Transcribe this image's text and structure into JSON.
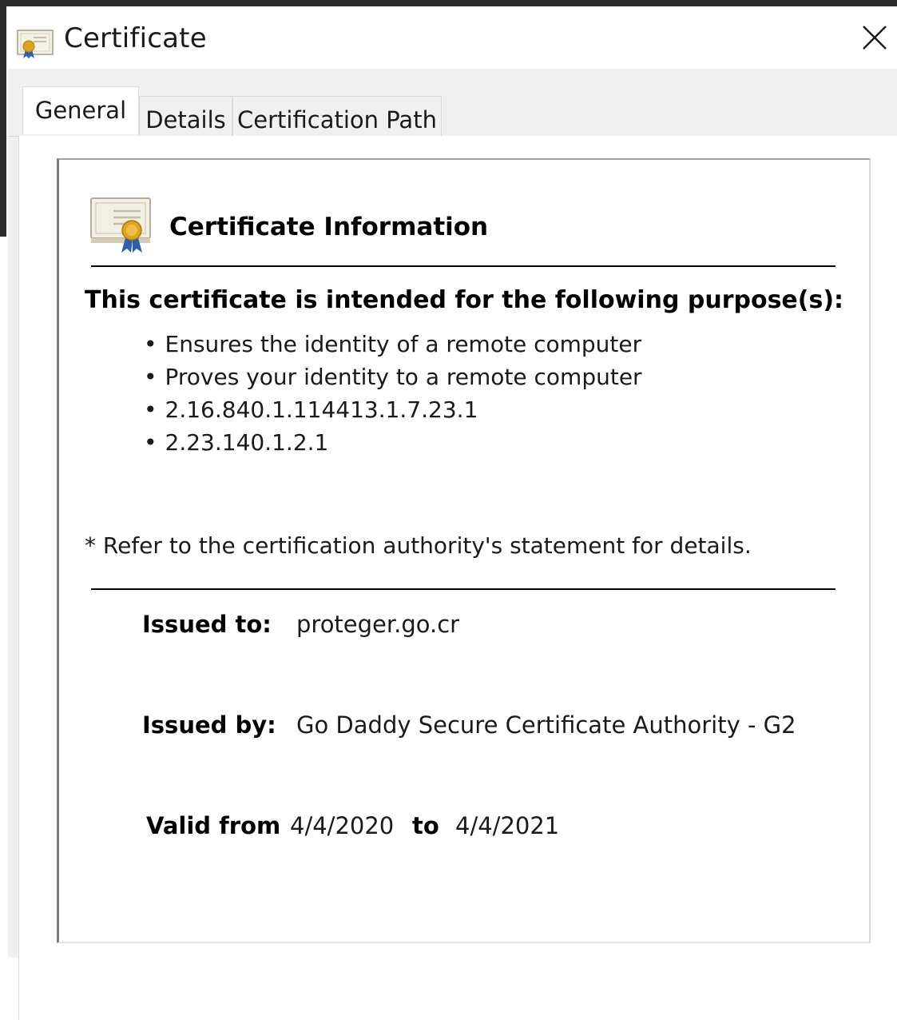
{
  "window": {
    "title": "Certificate",
    "title_icon": "certificate-icon",
    "close_icon": "close-icon"
  },
  "tabs": [
    {
      "label": "General",
      "active": true
    },
    {
      "label": "Details",
      "active": false
    },
    {
      "label": "Certification Path",
      "active": false
    }
  ],
  "general": {
    "section_title": "Certificate Information",
    "section_icon": "certificate-icon",
    "purpose_heading": "This certificate is intended for the following purpose(s):",
    "purposes": [
      "Ensures the identity of a remote computer",
      "Proves your identity to a remote computer",
      "2.16.840.1.114413.1.7.23.1",
      "2.23.140.1.2.1"
    ],
    "note": "* Refer to the certification authority's statement for details.",
    "issued_to": {
      "label": "Issued to:",
      "value": "proteger.go.cr"
    },
    "issued_by": {
      "label": "Issued by:",
      "value": "Go Daddy Secure Certificate Authority - G2"
    },
    "validity": {
      "from_label": "Valid from",
      "from": "4/4/2020",
      "to_label": "to",
      "to": "4/4/2021"
    }
  },
  "colors": {
    "frame": "#2b2b2b",
    "tab_background": "#f0f0f0",
    "seal_gold": "#e0a21c",
    "ribbon_blue": "#2f5fb3"
  }
}
